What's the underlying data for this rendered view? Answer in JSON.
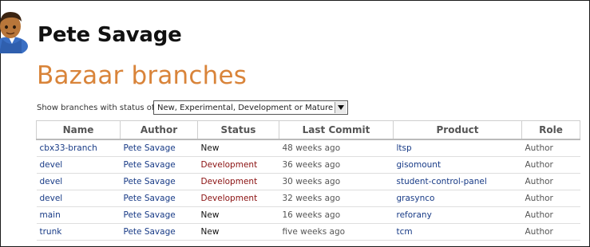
{
  "header": {
    "person_name": "Pete Savage",
    "page_title": "Bazaar branches"
  },
  "filter": {
    "label": "Show branches with status of",
    "selected": "New, Experimental, Development or Mature"
  },
  "table": {
    "columns": [
      "Name",
      "Author",
      "Status",
      "Last Commit",
      "Product",
      "Role"
    ],
    "rows": [
      {
        "name": "cbx33-branch",
        "author": "Pete Savage",
        "status": "New",
        "last_commit": "48 weeks ago",
        "product": "ltsp",
        "role": "Author"
      },
      {
        "name": "devel",
        "author": "Pete Savage",
        "status": "Development",
        "last_commit": "36 weeks ago",
        "product": "gisomount",
        "role": "Author"
      },
      {
        "name": "devel",
        "author": "Pete Savage",
        "status": "Development",
        "last_commit": "30 weeks ago",
        "product": "student-control-panel",
        "role": "Author"
      },
      {
        "name": "devel",
        "author": "Pete Savage",
        "status": "Development",
        "last_commit": "32 weeks ago",
        "product": "grasynco",
        "role": "Author"
      },
      {
        "name": "main",
        "author": "Pete Savage",
        "status": "New",
        "last_commit": "16 weeks ago",
        "product": "reforany",
        "role": "Author"
      },
      {
        "name": "trunk",
        "author": "Pete Savage",
        "status": "New",
        "last_commit": "five weeks ago",
        "product": "tcm",
        "role": "Author"
      }
    ]
  },
  "colors": {
    "title": "#d9843a",
    "link": "#173a86",
    "development_status": "#8a1010"
  },
  "icons": {
    "avatar": "person-avatar-icon",
    "dropdown": "dropdown-arrow-icon"
  }
}
